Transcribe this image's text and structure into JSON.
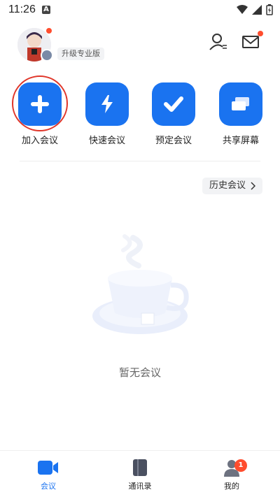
{
  "status": {
    "time": "11:26",
    "a_icon": "A"
  },
  "header": {
    "upgrade_label": "升级专业版"
  },
  "actions": [
    {
      "label": "加入会议",
      "icon": "plus-icon"
    },
    {
      "label": "快速会议",
      "icon": "lightning-icon"
    },
    {
      "label": "预定会议",
      "icon": "check-icon"
    },
    {
      "label": "共享屏幕",
      "icon": "share-screen-icon"
    }
  ],
  "history_label": "历史会议",
  "empty_text": "暂无会议",
  "tabs": [
    {
      "label": "会议",
      "active": true
    },
    {
      "label": "通讯录",
      "active": false
    },
    {
      "label": "我的",
      "active": false,
      "badge": "1"
    }
  ],
  "colors": {
    "accent": "#1a73f0",
    "dot": "#ff4d2e",
    "highlight": "#e0362a"
  }
}
